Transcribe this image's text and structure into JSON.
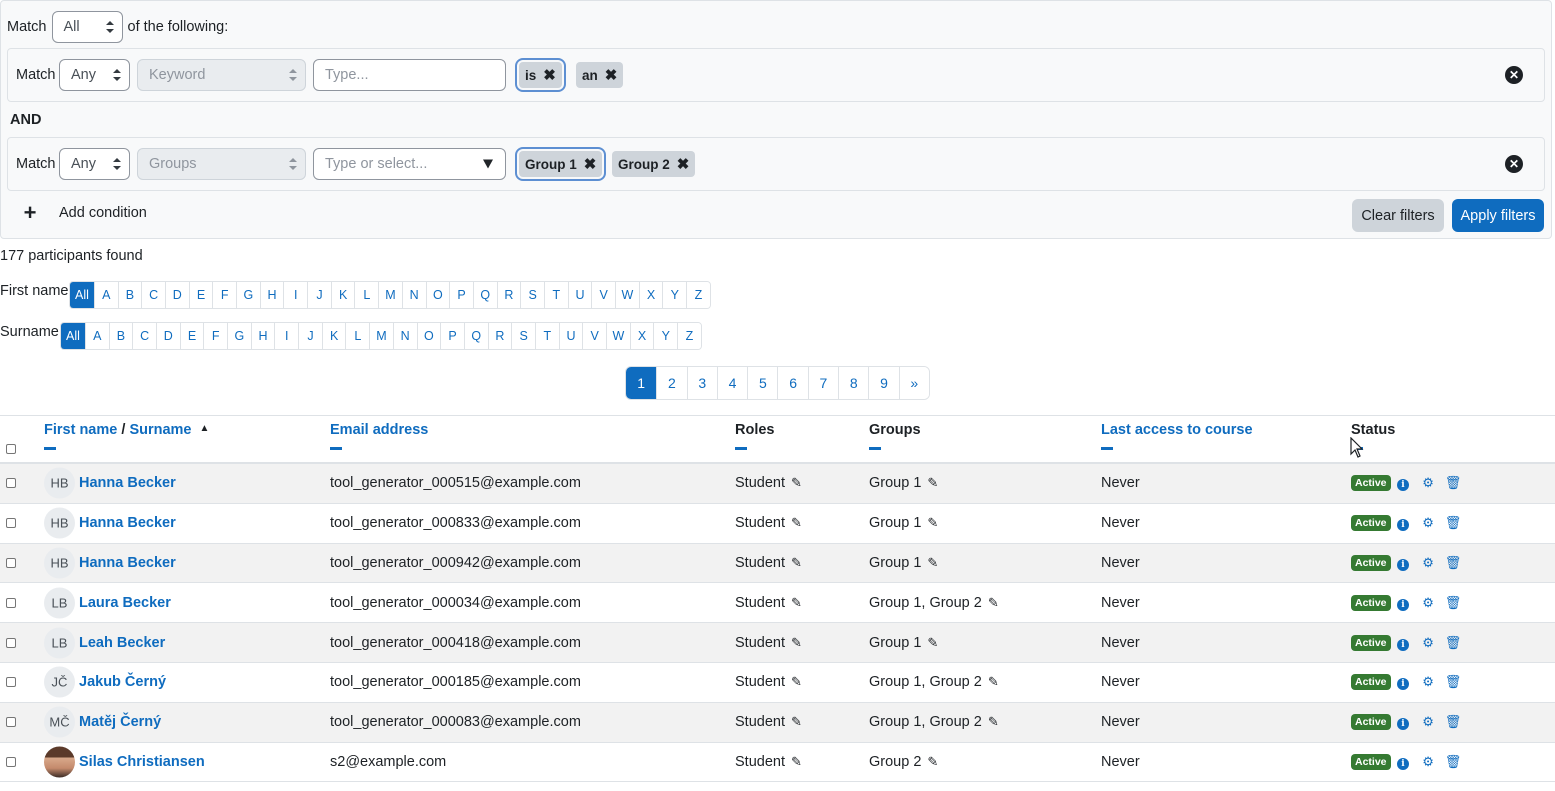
{
  "filter": {
    "match_label": "Match",
    "match_value": "All",
    "of_following": "of the following:",
    "conditions": [
      {
        "match_label": "Match",
        "match_value": "Any",
        "type_value": "Keyword",
        "input_placeholder": "Type...",
        "chips": [
          "is",
          "an"
        ]
      },
      {
        "match_label": "Match",
        "match_value": "Any",
        "type_value": "Groups",
        "input_placeholder": "Type or select...",
        "chips": [
          "Group 1",
          "Group 2"
        ]
      }
    ],
    "and_label": "AND",
    "add_condition": "Add condition",
    "clear_filters": "Clear filters",
    "apply_filters": "Apply filters"
  },
  "participants_found": "177 participants found",
  "initials": {
    "first_name_label": "First name",
    "surname_label": "Surname",
    "letters": [
      "All",
      "A",
      "B",
      "C",
      "D",
      "E",
      "F",
      "G",
      "H",
      "I",
      "J",
      "K",
      "L",
      "M",
      "N",
      "O",
      "P",
      "Q",
      "R",
      "S",
      "T",
      "U",
      "V",
      "W",
      "X",
      "Y",
      "Z"
    ]
  },
  "pagination": [
    "1",
    "2",
    "3",
    "4",
    "5",
    "6",
    "7",
    "8",
    "9",
    "»"
  ],
  "table": {
    "headers": {
      "first_name": "First name",
      "separator": " / ",
      "surname": "Surname",
      "email": "Email address",
      "roles": "Roles",
      "groups": "Groups",
      "last_access": "Last access to course",
      "status": "Status"
    },
    "rows": [
      {
        "initials": "HB",
        "name": "Hanna Becker",
        "email": "tool_generator_000515@example.com",
        "role": "Student",
        "groups": "Group 1",
        "last_access": "Never",
        "status": "Active"
      },
      {
        "initials": "HB",
        "name": "Hanna Becker",
        "email": "tool_generator_000833@example.com",
        "role": "Student",
        "groups": "Group 1",
        "last_access": "Never",
        "status": "Active"
      },
      {
        "initials": "HB",
        "name": "Hanna Becker",
        "email": "tool_generator_000942@example.com",
        "role": "Student",
        "groups": "Group 1",
        "last_access": "Never",
        "status": "Active"
      },
      {
        "initials": "LB",
        "name": "Laura Becker",
        "email": "tool_generator_000034@example.com",
        "role": "Student",
        "groups": "Group 1, Group 2",
        "last_access": "Never",
        "status": "Active"
      },
      {
        "initials": "LB",
        "name": "Leah Becker",
        "email": "tool_generator_000418@example.com",
        "role": "Student",
        "groups": "Group 1",
        "last_access": "Never",
        "status": "Active"
      },
      {
        "initials": "JČ",
        "name": "Jakub Černý",
        "email": "tool_generator_000185@example.com",
        "role": "Student",
        "groups": "Group 1, Group 2",
        "last_access": "Never",
        "status": "Active"
      },
      {
        "initials": "MČ",
        "name": "Matěj Černý",
        "email": "tool_generator_000083@example.com",
        "role": "Student",
        "groups": "Group 1, Group 2",
        "last_access": "Never",
        "status": "Active"
      },
      {
        "initials": "",
        "name": "Silas Christiansen",
        "email": "s2@example.com",
        "role": "Student",
        "groups": "Group 2",
        "last_access": "Never",
        "status": "Active",
        "photo": true
      }
    ]
  },
  "colors": {
    "primary": "#0f6cbf",
    "success": "#357a32",
    "chip": "#ced4da"
  }
}
